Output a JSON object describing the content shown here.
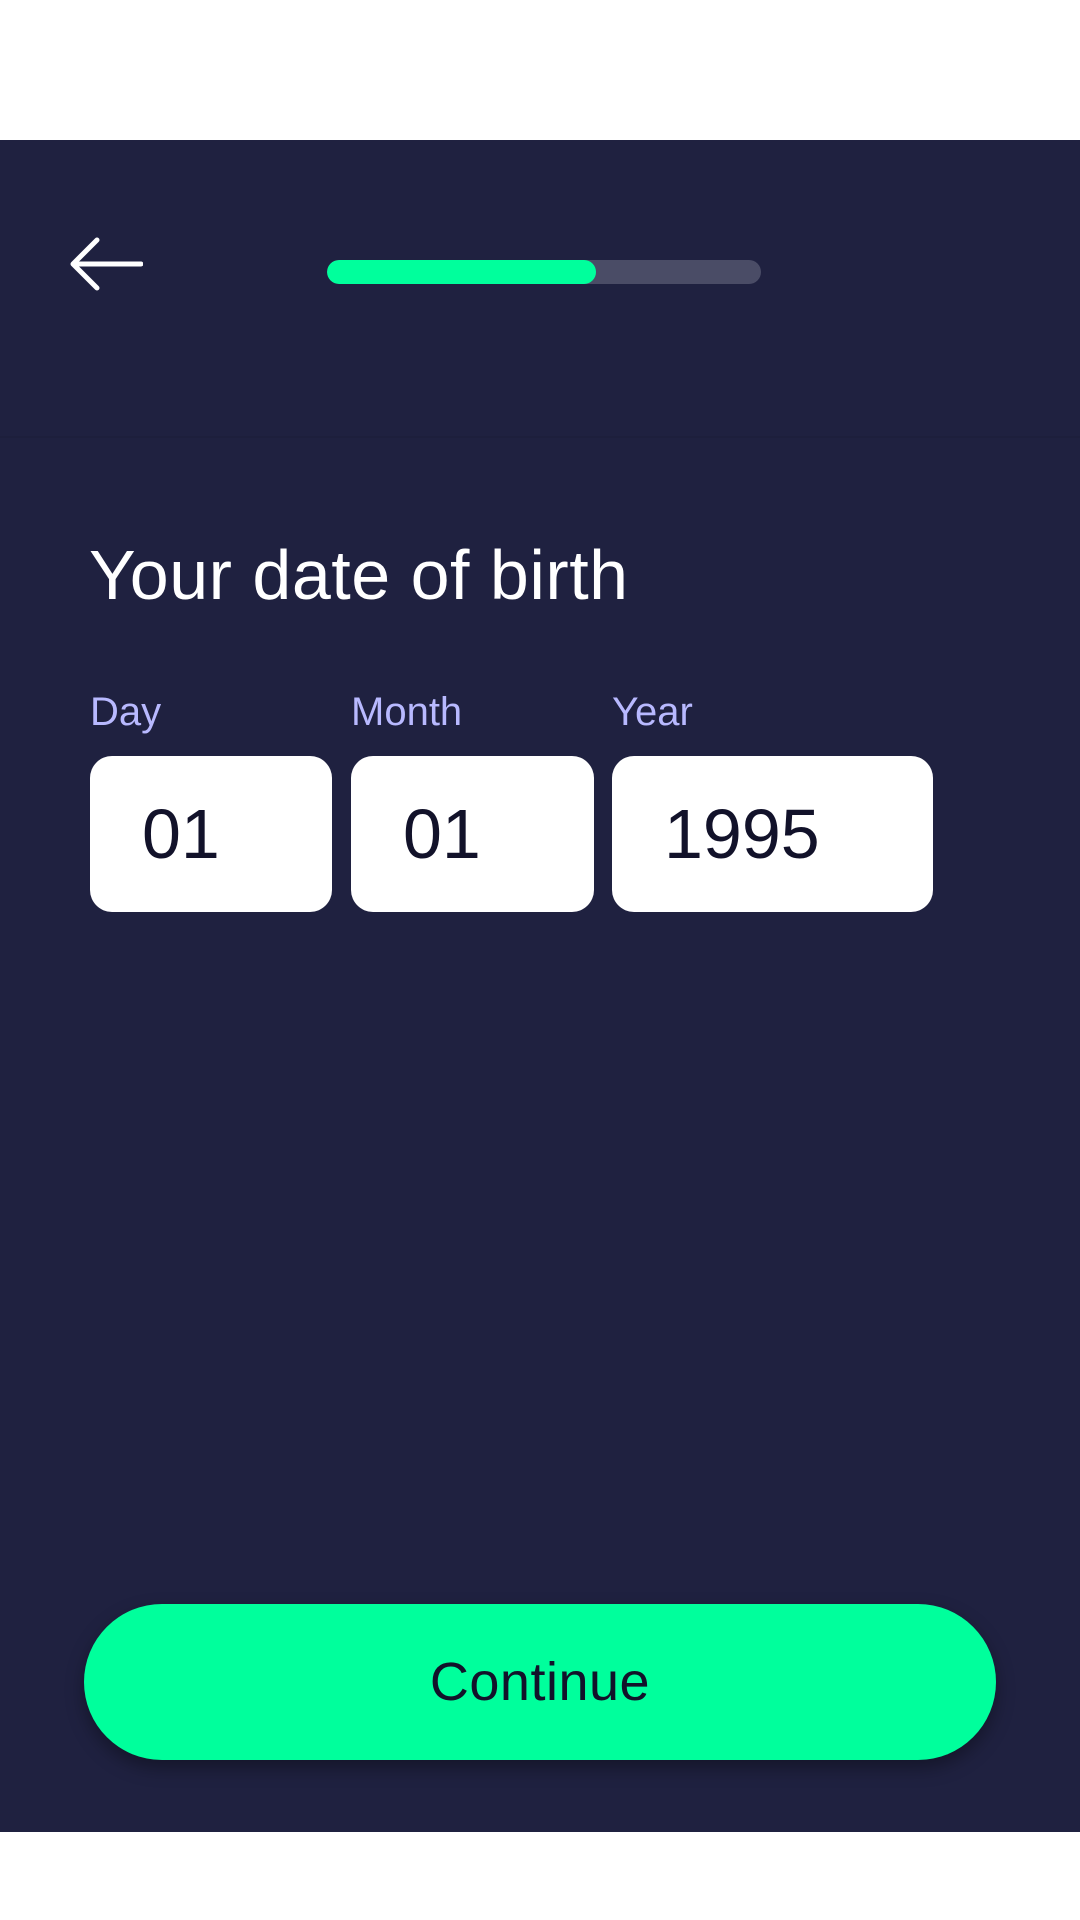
{
  "header": {
    "back_icon": "arrow-left-icon",
    "progress_fraction": 0.62
  },
  "main": {
    "title": "Your date of birth",
    "fields": {
      "day": {
        "label": "Day",
        "value": "01"
      },
      "month": {
        "label": "Month",
        "value": "01"
      },
      "year": {
        "label": "Year",
        "value": "1995"
      }
    }
  },
  "footer": {
    "continue_label": "Continue"
  },
  "colors": {
    "background": "#1f2140",
    "accent": "#00ff9c",
    "label": "#b8b9ff",
    "track": "#4a4c66"
  }
}
